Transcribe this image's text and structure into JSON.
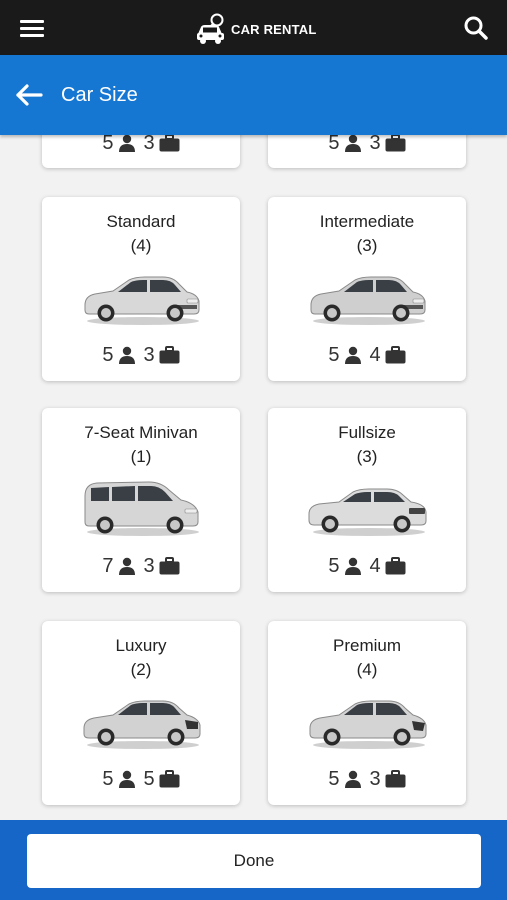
{
  "header": {
    "brand_text": "CAR RENTAL",
    "menu_icon": "hamburger-menu-icon",
    "search_icon": "search-icon",
    "logo_icon": "car-search-logo-icon"
  },
  "titlebar": {
    "title": "Car Size",
    "back_icon": "arrow-left-icon"
  },
  "partial_cards": [
    {
      "passengers": "5",
      "bags": "3"
    },
    {
      "passengers": "5",
      "bags": "3"
    }
  ],
  "cards": [
    {
      "name": "Standard",
      "count": "(4)",
      "passengers": "5",
      "bags": "3",
      "car_style": "sedan"
    },
    {
      "name": "Intermediate",
      "count": "(3)",
      "passengers": "5",
      "bags": "4",
      "car_style": "sedan"
    },
    {
      "name": "7-Seat Minivan",
      "count": "(1)",
      "passengers": "7",
      "bags": "3",
      "car_style": "minivan"
    },
    {
      "name": "Fullsize",
      "count": "(3)",
      "passengers": "5",
      "bags": "4",
      "car_style": "sedan"
    },
    {
      "name": "Luxury",
      "count": "(2)",
      "passengers": "5",
      "bags": "5",
      "car_style": "sedan"
    },
    {
      "name": "Premium",
      "count": "(4)",
      "passengers": "5",
      "bags": "3",
      "car_style": "sedan"
    }
  ],
  "footer": {
    "done_label": "Done"
  },
  "colors": {
    "header_bg": "#1a1a1a",
    "title_bar_bg": "#1577d2",
    "footer_bg": "#1566c6",
    "card_bg": "#ffffff",
    "page_bg": "#f2f2f2"
  }
}
